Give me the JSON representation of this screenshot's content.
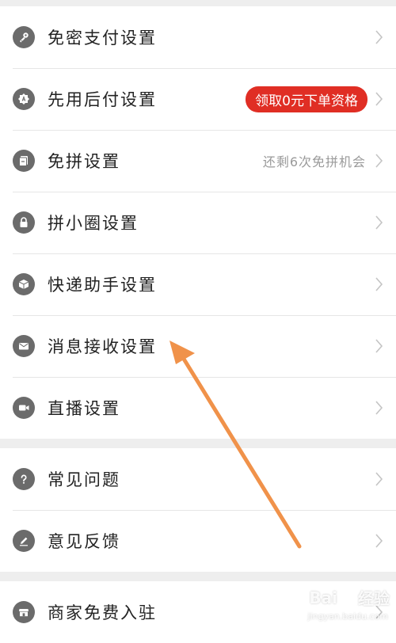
{
  "groups": [
    {
      "items": [
        {
          "label": "免密支付设置",
          "icon": "key-icon"
        },
        {
          "label": "先用后付设置",
          "icon": "badge-icon",
          "badge": "领取0元下单资格"
        },
        {
          "label": "免拼设置",
          "icon": "ticket-icon",
          "hint": "还剩6次免拼机会"
        },
        {
          "label": "拼小圈设置",
          "icon": "lock-icon"
        },
        {
          "label": "快递助手设置",
          "icon": "package-icon"
        },
        {
          "label": "消息接收设置",
          "icon": "mail-icon"
        },
        {
          "label": "直播设置",
          "icon": "video-icon"
        }
      ]
    },
    {
      "items": [
        {
          "label": "常见问题",
          "icon": "question-icon"
        },
        {
          "label": "意见反馈",
          "icon": "pencil-icon"
        }
      ]
    },
    {
      "items": [
        {
          "label": "商家免费入驻",
          "icon": "store-icon"
        }
      ]
    }
  ],
  "watermark": {
    "text_left": "Bai",
    "text_right": "经验",
    "sub": "jingyan.baidu.com"
  },
  "colors": {
    "icon": "#6b6b6b",
    "badge": "#e02e24",
    "arrow": "#f0924a",
    "hint": "#9a9a9a"
  }
}
